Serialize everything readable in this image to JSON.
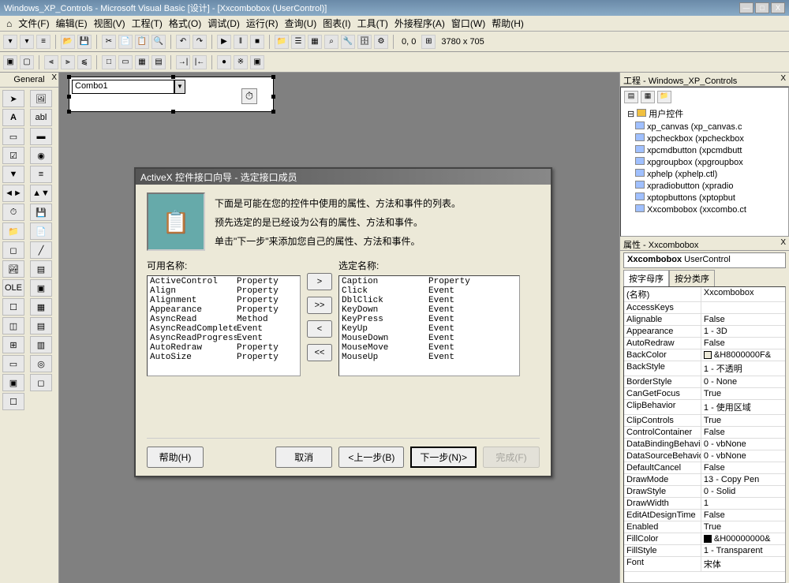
{
  "window": {
    "title": "Windows_XP_Controls - Microsoft Visual Basic [设计] - [Xxcombobox (UserControl)]"
  },
  "menus": [
    "文件(F)",
    "编辑(E)",
    "视图(V)",
    "工程(T)",
    "格式(O)",
    "调试(D)",
    "运行(R)",
    "查询(U)",
    "图表(I)",
    "工具(T)",
    "外接程序(A)",
    "窗口(W)",
    "帮助(H)"
  ],
  "toolbar2": {
    "coords": "0, 0",
    "size": "3780 x 705"
  },
  "toolbox_header": "General",
  "design": {
    "combo_text": "Combo1"
  },
  "wizard": {
    "title": "ActiveX 控件接口向导 - 选定接口成员",
    "intro_lines": [
      "下面是可能在您的控件中使用的属性、方法和事件的列表。",
      "预先选定的是已经设为公有的属性、方法和事件。",
      "单击\"下一步\"来添加您自己的属性、方法和事件。"
    ],
    "available_label": "可用名称:",
    "selected_label": "选定名称:",
    "available": [
      {
        "name": "ActiveControl",
        "type": "Property"
      },
      {
        "name": "Align",
        "type": "Property"
      },
      {
        "name": "Alignment",
        "type": "Property"
      },
      {
        "name": "Appearance",
        "type": "Property"
      },
      {
        "name": "AsyncRead",
        "type": "Method"
      },
      {
        "name": "AsyncReadComplete",
        "type": "Event"
      },
      {
        "name": "AsyncReadProgress",
        "type": "Event"
      },
      {
        "name": "AutoRedraw",
        "type": "Property"
      },
      {
        "name": "AutoSize",
        "type": "Property"
      }
    ],
    "selected": [
      {
        "name": "Caption",
        "type": "Property"
      },
      {
        "name": "Click",
        "type": "Event"
      },
      {
        "name": "DblClick",
        "type": "Event"
      },
      {
        "name": "KeyDown",
        "type": "Event"
      },
      {
        "name": "KeyPress",
        "type": "Event"
      },
      {
        "name": "KeyUp",
        "type": "Event"
      },
      {
        "name": "MouseDown",
        "type": "Event"
      },
      {
        "name": "MouseMove",
        "type": "Event"
      },
      {
        "name": "MouseUp",
        "type": "Event"
      }
    ],
    "buttons": {
      "help": "帮助(H)",
      "cancel": "取消",
      "back": "<上一步(B)",
      "next": "下一步(N)>",
      "finish": "完成(F)"
    }
  },
  "project": {
    "title": "工程 - Windows_XP_Controls",
    "folder": "用户控件",
    "items": [
      "xp_canvas (xp_canvas.c",
      "xpcheckbox (xpcheckbox",
      "xpcmdbutton (xpcmdbutt",
      "xpgroupbox (xpgroupbox",
      "xphelp (xphelp.ctl)",
      "xpradiobutton (xpradio",
      "xptopbuttons (xptopbut",
      "Xxcombobox (xxcombo.ct"
    ]
  },
  "properties": {
    "title": "属性 - Xxcombobox",
    "object": {
      "name": "Xxcombobox",
      "type": "UserControl"
    },
    "tabs": {
      "alpha": "按字母序",
      "category": "按分类序"
    },
    "rows": [
      {
        "n": "(名称)",
        "v": "Xxcombobox"
      },
      {
        "n": "AccessKeys",
        "v": ""
      },
      {
        "n": "Alignable",
        "v": "False"
      },
      {
        "n": "Appearance",
        "v": "1 - 3D"
      },
      {
        "n": "AutoRedraw",
        "v": "False"
      },
      {
        "n": "BackColor",
        "v": "&H8000000F&",
        "swatch": "#ece9d8"
      },
      {
        "n": "BackStyle",
        "v": "1 - 不透明"
      },
      {
        "n": "BorderStyle",
        "v": "0 - None"
      },
      {
        "n": "CanGetFocus",
        "v": "True"
      },
      {
        "n": "ClipBehavior",
        "v": "1 - 使用区域"
      },
      {
        "n": "ClipControls",
        "v": "True"
      },
      {
        "n": "ControlContainer",
        "v": "False"
      },
      {
        "n": "DataBindingBehavi",
        "v": "0 - vbNone"
      },
      {
        "n": "DataSourceBehavio",
        "v": "0 - vbNone"
      },
      {
        "n": "DefaultCancel",
        "v": "False"
      },
      {
        "n": "DrawMode",
        "v": "13 - Copy Pen"
      },
      {
        "n": "DrawStyle",
        "v": "0 - Solid"
      },
      {
        "n": "DrawWidth",
        "v": "1"
      },
      {
        "n": "EditAtDesignTime",
        "v": "False"
      },
      {
        "n": "Enabled",
        "v": "True"
      },
      {
        "n": "FillColor",
        "v": "&H00000000&",
        "swatch": "#000000"
      },
      {
        "n": "FillStyle",
        "v": "1 - Transparent"
      },
      {
        "n": "Font",
        "v": "宋体"
      }
    ]
  }
}
